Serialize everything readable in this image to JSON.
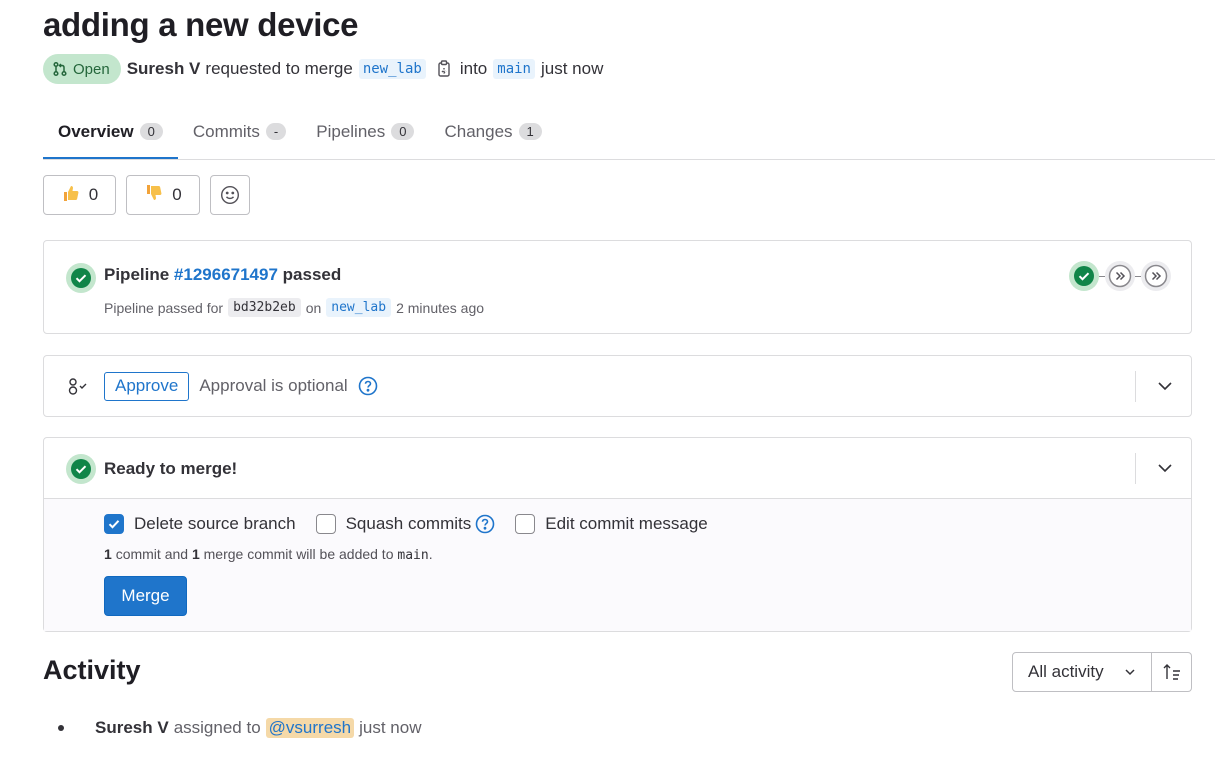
{
  "mr": {
    "title": "adding a new device",
    "status_label": "Open",
    "author": "Suresh V",
    "requested_text": "requested to merge",
    "source_branch": "new_lab",
    "into_text": "into",
    "target_branch": "main",
    "time": "just now"
  },
  "tabs": [
    {
      "label": "Overview",
      "count": "0"
    },
    {
      "label": "Commits",
      "count": "-"
    },
    {
      "label": "Pipelines",
      "count": "0"
    },
    {
      "label": "Changes",
      "count": "1"
    }
  ],
  "reactions": {
    "thumbs_up_count": "0",
    "thumbs_down_count": "0"
  },
  "pipeline": {
    "prefix": "Pipeline",
    "id": "#1296671497",
    "status": "passed",
    "sub_prefix": "Pipeline passed for",
    "commit": "bd32b2eb",
    "on_text": "on",
    "branch": "new_lab",
    "time": "2 minutes ago"
  },
  "approval": {
    "button_label": "Approve",
    "text": "Approval is optional"
  },
  "merge": {
    "status_text": "Ready to merge!",
    "options": {
      "delete_source_branch": "Delete source branch",
      "squash_commits": "Squash commits",
      "edit_commit_message": "Edit commit message"
    },
    "delete_checked": true,
    "squash_checked": false,
    "edit_checked": false,
    "note": {
      "count1": "1",
      "text1": "commit and",
      "count2": "1",
      "text2": "merge commit will be added to",
      "branch": "main",
      "end": "."
    },
    "button_label": "Merge"
  },
  "activity": {
    "title": "Activity",
    "filter_label": "All activity",
    "items": [
      {
        "author": "Suresh V",
        "action": "assigned to",
        "mention": "@vsurresh",
        "time": "just now"
      }
    ]
  },
  "colors": {
    "brand_blue": "#1f75cb",
    "success_green": "#108548",
    "open_badge_bg": "#c3e6cd",
    "mention_bg": "#f5d9a8"
  }
}
